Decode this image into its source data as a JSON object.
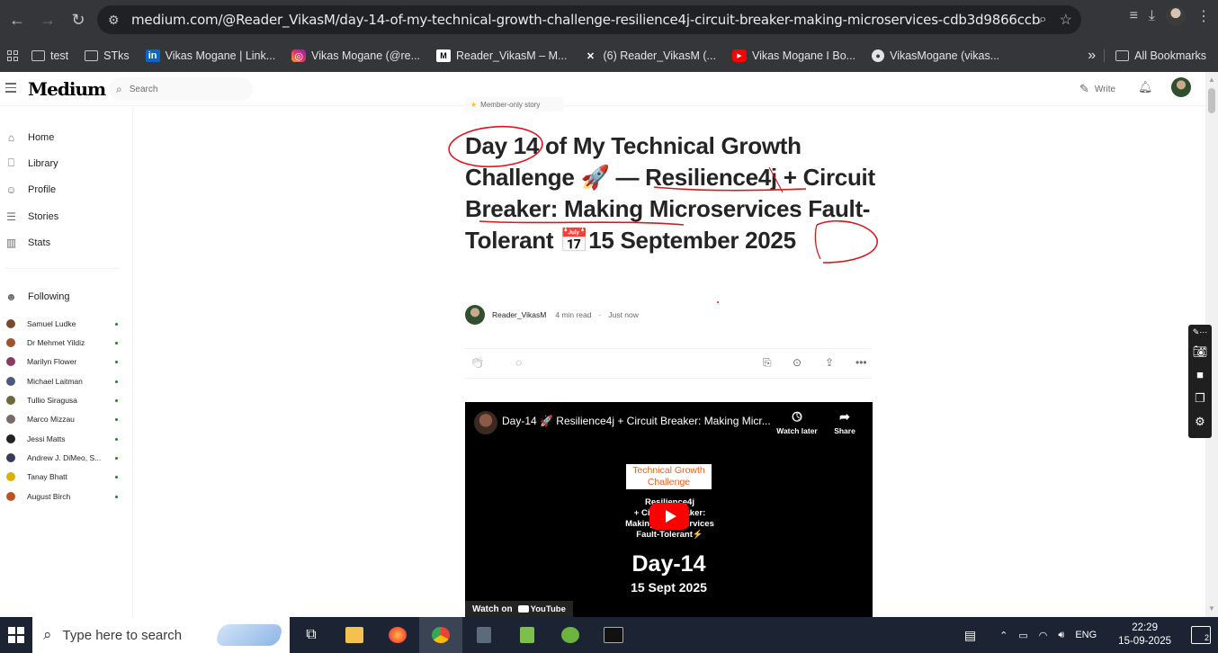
{
  "browser": {
    "url": "medium.com/@Reader_VikasM/day-14-of-my-technical-growth-challenge-resilience4j-circuit-breaker-making-microservices-cdb3d9866ccb",
    "bookmarks": [
      {
        "label": "test",
        "icon": "folder-icon"
      },
      {
        "label": "STks",
        "icon": "folder-icon"
      },
      {
        "label": "Vikas Mogane | Link...",
        "icon": "linkedin-icon",
        "color": "#0a66c2"
      },
      {
        "label": "Vikas Mogane (@re...",
        "icon": "instagram-icon",
        "color": "#e1306c"
      },
      {
        "label": "Reader_VikasM – M...",
        "icon": "medium-icon",
        "color": "#ffffff"
      },
      {
        "label": "(6) Reader_VikasM (...",
        "icon": "x-icon",
        "color": "#ffffff"
      },
      {
        "label": "Vikas Mogane I Bo...",
        "icon": "youtube-icon",
        "color": "#ff0000"
      },
      {
        "label": "VikasMogane (vikas...",
        "icon": "github-icon",
        "color": "#ffffff"
      }
    ],
    "more_bookmarks": "»",
    "all_bookmarks": "All Bookmarks"
  },
  "header": {
    "logo": "Medium",
    "search_placeholder": "Search",
    "write_label": "Write"
  },
  "sidebar": {
    "nav": [
      {
        "label": "Home",
        "icon": "home-icon"
      },
      {
        "label": "Library",
        "icon": "bookmark-icon"
      },
      {
        "label": "Profile",
        "icon": "profile-icon"
      },
      {
        "label": "Stories",
        "icon": "stories-icon"
      },
      {
        "label": "Stats",
        "icon": "stats-icon"
      }
    ],
    "following_label": "Following",
    "following": [
      {
        "name": "Samuel Ludke",
        "color": "#7a4a2f"
      },
      {
        "name": "Dr Mehmet Yildiz",
        "color": "#a0522d"
      },
      {
        "name": "Marilyn Flower",
        "color": "#8b3a62"
      },
      {
        "name": "Michael Laitman",
        "color": "#4a5a7a"
      },
      {
        "name": "Tullio Siragusa",
        "color": "#6b6b3a"
      },
      {
        "name": "Marco Mizzau",
        "color": "#7a6a6a"
      },
      {
        "name": "Jessi Matts",
        "color": "#222222"
      },
      {
        "name": "Andrew J. DiMeo, S...",
        "color": "#3a3a5a"
      },
      {
        "name": "Tanay Bhatt",
        "color": "#e0b000"
      },
      {
        "name": "August Birch",
        "color": "#c05020"
      }
    ]
  },
  "article": {
    "badge": "Member-only story",
    "title_parts": {
      "t1": "Day 14",
      "t2": " of My Technical Growth Challenge ",
      "t3": "🚀",
      "t4": " — ",
      "t5": "Resilience4j",
      "t6": " +",
      "t7": "Circuit Breaker:",
      "t8": " Making Microservices Fault-Tolerant ",
      "t9": "📅",
      "t10": "15",
      "t11": " September 2025"
    },
    "author": "Reader_VikasM",
    "read_time": "4 min read",
    "separator": "·",
    "published": "Just now"
  },
  "video": {
    "title": "Day-14 🚀 Resilience4j + Circuit Breaker: Making Micr...",
    "watch_later": "Watch later",
    "share": "Share",
    "card_title": "Technical Growth Challenge",
    "subtitle_lines": [
      "Resilience4j",
      "+ Circuit Breaker:",
      "Making Microservices",
      "Fault-Tolerant⚡"
    ],
    "day": "Day-14",
    "date": "15 Sept 2025",
    "watch_on": "Watch on",
    "youtube": "YouTube"
  },
  "taskbar": {
    "search_placeholder": "Type here to search",
    "language": "ENG",
    "time": "22:29",
    "date": "15-09-2025",
    "notifications": "2"
  }
}
